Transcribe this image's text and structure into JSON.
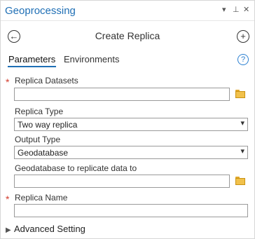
{
  "window": {
    "title": "Geoprocessing",
    "controls": [
      "▾",
      "⊥",
      "✕"
    ]
  },
  "nav": {
    "back_glyph": "←",
    "add_glyph": "+",
    "heading": "Create Replica"
  },
  "tabs": [
    {
      "label": "Parameters",
      "active": true
    },
    {
      "label": "Environments",
      "active": false
    }
  ],
  "help_glyph": "?",
  "form": {
    "replica_datasets": {
      "label": "Replica Datasets",
      "value": "",
      "required": true
    },
    "replica_type": {
      "label": "Replica Type",
      "value": "Two way replica"
    },
    "output_type": {
      "label": "Output Type",
      "value": "Geodatabase"
    },
    "target_gdb": {
      "label": "Geodatabase to replicate data to",
      "value": ""
    },
    "replica_name": {
      "label": "Replica Name",
      "value": "",
      "required": true
    }
  },
  "required_marker": "*",
  "advanced": {
    "label": "Advanced Setting",
    "chevron": "▶"
  },
  "colors": {
    "accent": "#1f6fb5",
    "required": "#d23b2c",
    "folder": "#f1c14b"
  },
  "icons": [
    "back-arrow-icon",
    "add-icon",
    "help-icon",
    "folder-icon",
    "pin-icon",
    "close-icon",
    "chevron-right-icon"
  ]
}
